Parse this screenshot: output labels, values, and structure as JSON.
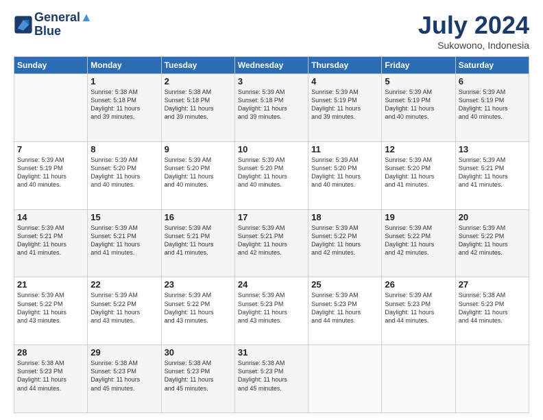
{
  "logo": {
    "line1": "General",
    "line2": "Blue"
  },
  "title": "July 2024",
  "location": "Sukowono, Indonesia",
  "weekdays": [
    "Sunday",
    "Monday",
    "Tuesday",
    "Wednesday",
    "Thursday",
    "Friday",
    "Saturday"
  ],
  "weeks": [
    [
      {
        "day": "",
        "info": ""
      },
      {
        "day": "1",
        "info": "Sunrise: 5:38 AM\nSunset: 5:18 PM\nDaylight: 11 hours\nand 39 minutes."
      },
      {
        "day": "2",
        "info": "Sunrise: 5:38 AM\nSunset: 5:18 PM\nDaylight: 11 hours\nand 39 minutes."
      },
      {
        "day": "3",
        "info": "Sunrise: 5:39 AM\nSunset: 5:18 PM\nDaylight: 11 hours\nand 39 minutes."
      },
      {
        "day": "4",
        "info": "Sunrise: 5:39 AM\nSunset: 5:19 PM\nDaylight: 11 hours\nand 39 minutes."
      },
      {
        "day": "5",
        "info": "Sunrise: 5:39 AM\nSunset: 5:19 PM\nDaylight: 11 hours\nand 40 minutes."
      },
      {
        "day": "6",
        "info": "Sunrise: 5:39 AM\nSunset: 5:19 PM\nDaylight: 11 hours\nand 40 minutes."
      }
    ],
    [
      {
        "day": "7",
        "info": "Sunrise: 5:39 AM\nSunset: 5:19 PM\nDaylight: 11 hours\nand 40 minutes."
      },
      {
        "day": "8",
        "info": "Sunrise: 5:39 AM\nSunset: 5:20 PM\nDaylight: 11 hours\nand 40 minutes."
      },
      {
        "day": "9",
        "info": "Sunrise: 5:39 AM\nSunset: 5:20 PM\nDaylight: 11 hours\nand 40 minutes."
      },
      {
        "day": "10",
        "info": "Sunrise: 5:39 AM\nSunset: 5:20 PM\nDaylight: 11 hours\nand 40 minutes."
      },
      {
        "day": "11",
        "info": "Sunrise: 5:39 AM\nSunset: 5:20 PM\nDaylight: 11 hours\nand 40 minutes."
      },
      {
        "day": "12",
        "info": "Sunrise: 5:39 AM\nSunset: 5:20 PM\nDaylight: 11 hours\nand 41 minutes."
      },
      {
        "day": "13",
        "info": "Sunrise: 5:39 AM\nSunset: 5:21 PM\nDaylight: 11 hours\nand 41 minutes."
      }
    ],
    [
      {
        "day": "14",
        "info": "Sunrise: 5:39 AM\nSunset: 5:21 PM\nDaylight: 11 hours\nand 41 minutes."
      },
      {
        "day": "15",
        "info": "Sunrise: 5:39 AM\nSunset: 5:21 PM\nDaylight: 11 hours\nand 41 minutes."
      },
      {
        "day": "16",
        "info": "Sunrise: 5:39 AM\nSunset: 5:21 PM\nDaylight: 11 hours\nand 41 minutes."
      },
      {
        "day": "17",
        "info": "Sunrise: 5:39 AM\nSunset: 5:21 PM\nDaylight: 11 hours\nand 42 minutes."
      },
      {
        "day": "18",
        "info": "Sunrise: 5:39 AM\nSunset: 5:22 PM\nDaylight: 11 hours\nand 42 minutes."
      },
      {
        "day": "19",
        "info": "Sunrise: 5:39 AM\nSunset: 5:22 PM\nDaylight: 11 hours\nand 42 minutes."
      },
      {
        "day": "20",
        "info": "Sunrise: 5:39 AM\nSunset: 5:22 PM\nDaylight: 11 hours\nand 42 minutes."
      }
    ],
    [
      {
        "day": "21",
        "info": "Sunrise: 5:39 AM\nSunset: 5:22 PM\nDaylight: 11 hours\nand 43 minutes."
      },
      {
        "day": "22",
        "info": "Sunrise: 5:39 AM\nSunset: 5:22 PM\nDaylight: 11 hours\nand 43 minutes."
      },
      {
        "day": "23",
        "info": "Sunrise: 5:39 AM\nSunset: 5:22 PM\nDaylight: 11 hours\nand 43 minutes."
      },
      {
        "day": "24",
        "info": "Sunrise: 5:39 AM\nSunset: 5:23 PM\nDaylight: 11 hours\nand 43 minutes."
      },
      {
        "day": "25",
        "info": "Sunrise: 5:39 AM\nSunset: 5:23 PM\nDaylight: 11 hours\nand 44 minutes."
      },
      {
        "day": "26",
        "info": "Sunrise: 5:39 AM\nSunset: 5:23 PM\nDaylight: 11 hours\nand 44 minutes."
      },
      {
        "day": "27",
        "info": "Sunrise: 5:38 AM\nSunset: 5:23 PM\nDaylight: 11 hours\nand 44 minutes."
      }
    ],
    [
      {
        "day": "28",
        "info": "Sunrise: 5:38 AM\nSunset: 5:23 PM\nDaylight: 11 hours\nand 44 minutes."
      },
      {
        "day": "29",
        "info": "Sunrise: 5:38 AM\nSunset: 5:23 PM\nDaylight: 11 hours\nand 45 minutes."
      },
      {
        "day": "30",
        "info": "Sunrise: 5:38 AM\nSunset: 5:23 PM\nDaylight: 11 hours\nand 45 minutes."
      },
      {
        "day": "31",
        "info": "Sunrise: 5:38 AM\nSunset: 5:23 PM\nDaylight: 11 hours\nand 45 minutes."
      },
      {
        "day": "",
        "info": ""
      },
      {
        "day": "",
        "info": ""
      },
      {
        "day": "",
        "info": ""
      }
    ]
  ]
}
